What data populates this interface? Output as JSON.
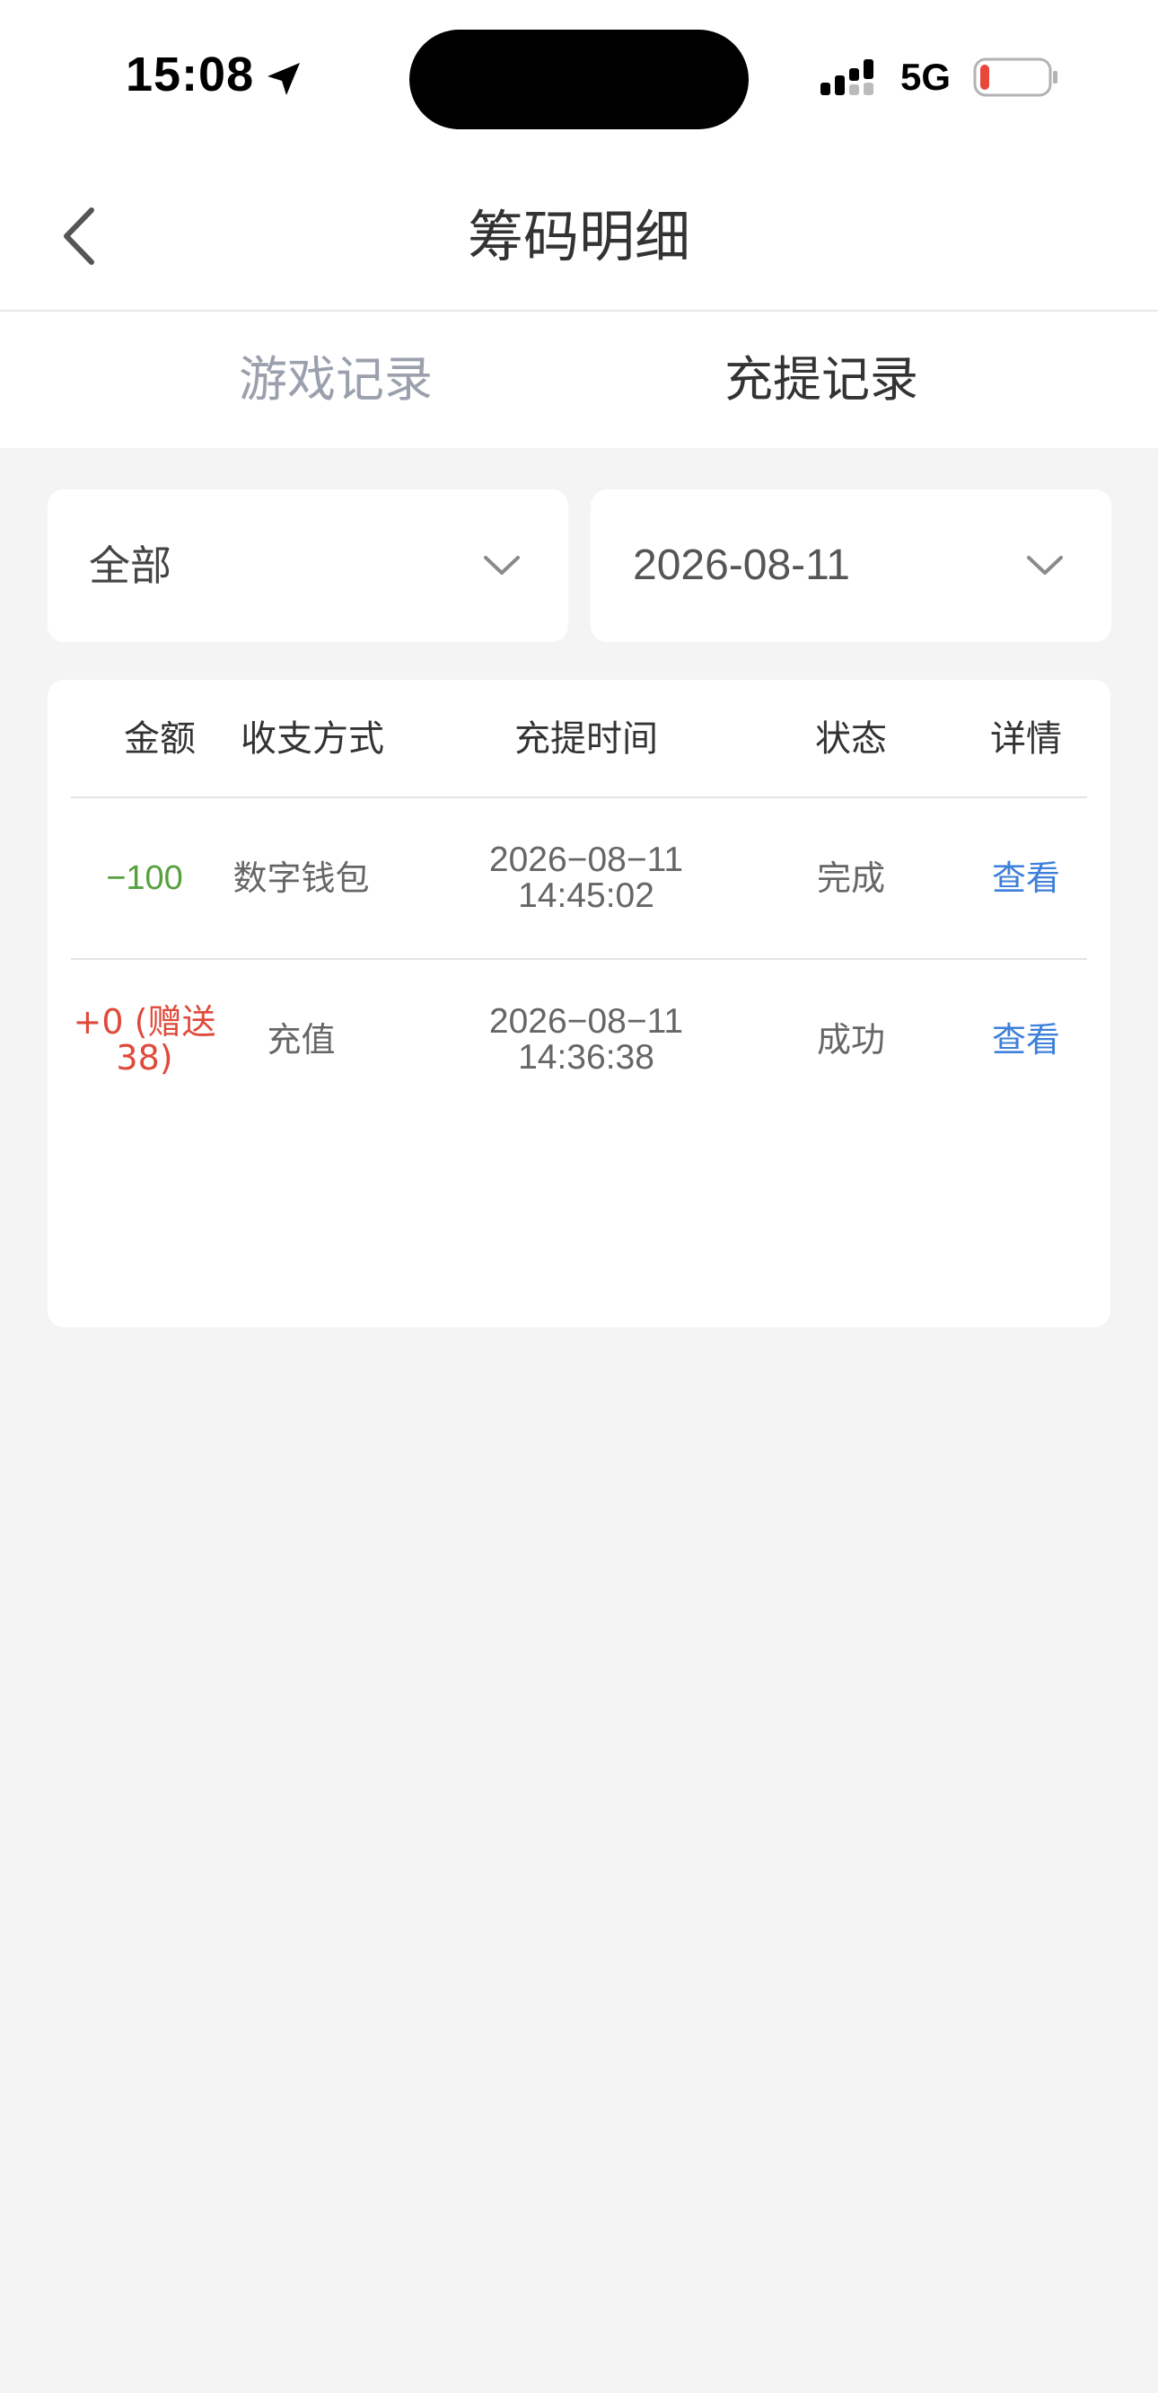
{
  "status_bar": {
    "time": "15:08",
    "network": "5G"
  },
  "header": {
    "title": "筹码明细"
  },
  "tabs": [
    {
      "label": "游戏记录",
      "active": false
    },
    {
      "label": "充提记录",
      "active": true
    }
  ],
  "filters": {
    "type": "全部",
    "date": "2026-08-11"
  },
  "table": {
    "columns": [
      "金额",
      "收支方式",
      "充提时间",
      "状态",
      "详情"
    ],
    "rows": [
      {
        "amount": "−100",
        "method": "数字钱包",
        "date": "2026−08−11",
        "time": "14:45:02",
        "status": "完成",
        "detail": "查看"
      },
      {
        "amount": "+0 (赠送38)",
        "method": "充值",
        "date": "2026−08−11",
        "time": "14:36:38",
        "status": "成功",
        "detail": "查看"
      }
    ]
  },
  "colors": {
    "negative": "#55a13e",
    "positive": "#df4a3b",
    "link": "#3d7fd9",
    "battery_low": "#e8473a"
  }
}
